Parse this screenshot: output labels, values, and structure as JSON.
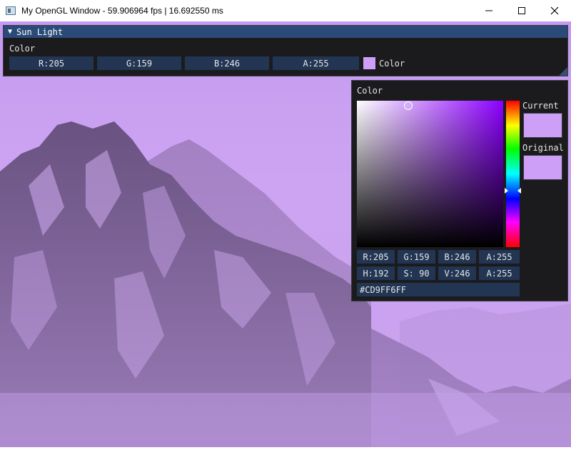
{
  "window": {
    "title": "My OpenGL Window - 59.906964 fps | 16.692550 ms",
    "icon": "app-window-icon",
    "controls": [
      "minimize-icon",
      "maximize-icon",
      "close-icon"
    ]
  },
  "sun_window": {
    "title": "Sun Light",
    "label": "Color",
    "channels": [
      "R:205",
      "G:159",
      "B:246",
      "A:255"
    ],
    "swatch_label": "Color",
    "swatch_color": "#CD9FF6"
  },
  "picker": {
    "title": "Color",
    "current_label": "Current",
    "original_label": "Original",
    "current_color": "#CD9FF6",
    "original_color": "#CD9FF6",
    "hue_color": "#8C00FF",
    "rgba": [
      "R:205",
      "G:159",
      "B:246",
      "A:255"
    ],
    "hsva": [
      "H:192",
      "S: 90",
      "V:246",
      "A:255"
    ],
    "hex": "#CD9FF6FF"
  },
  "colors": {
    "imgui_bg": "#1B1B1E",
    "imgui_header": "#2A4A78",
    "imgui_frame": "#223553",
    "scene_tint": "#CDA4F2"
  }
}
